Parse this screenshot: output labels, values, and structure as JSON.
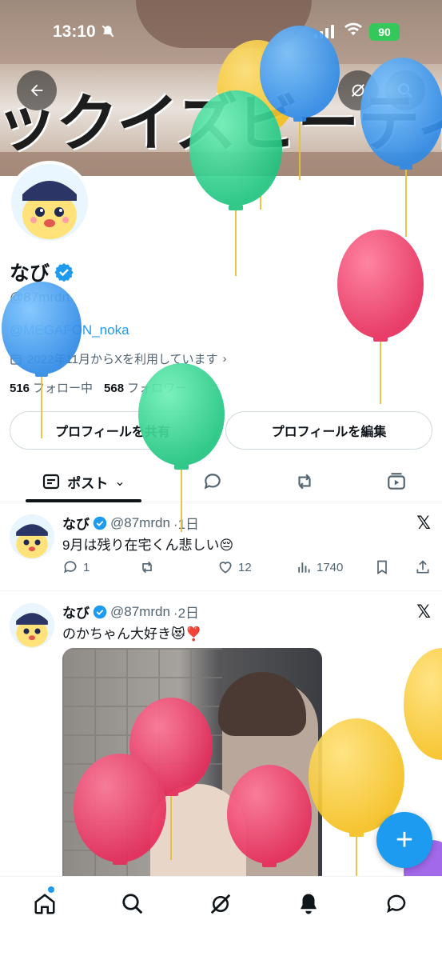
{
  "status_bar": {
    "time": "13:10",
    "battery": "90"
  },
  "header": {
    "banner_text": "ックイズビーティル"
  },
  "profile": {
    "name": "なび",
    "handle": "@87mrdn",
    "bio_link": "@MEGAFON_noka",
    "joined": "2022年11月からXを利用しています",
    "following_count": "516",
    "following_label": "フォロー中",
    "followers_count": "568",
    "followers_label": "フォロワー",
    "share_button": "プロフィールを共有",
    "edit_button": "プロフィールを編集"
  },
  "tabs": {
    "posts_label": "ポスト"
  },
  "posts": [
    {
      "name": "なび",
      "handle": "@87mrdn",
      "time": "·1日",
      "text": "9月は残り在宅くん悲しい😔",
      "replies": "1",
      "reposts": "",
      "likes": "12",
      "views": "1740"
    },
    {
      "name": "なび",
      "handle": "@87mrdn",
      "time": "·2日",
      "text": "のかちゃん大好き😻❣️"
    }
  ],
  "icons": {
    "back": "arrow-left-icon",
    "grok": "grok-icon",
    "search": "search-icon",
    "calendar": "calendar-icon",
    "verified": "verified-badge-icon",
    "x_logo": "x-logo-icon",
    "compose": "plus-icon"
  },
  "colors": {
    "accent": "#1d9bf0",
    "battery": "#34c759",
    "balloon_blue": "#3d9bef",
    "balloon_green": "#2fd38f",
    "balloon_pink": "#ef3c6a",
    "balloon_yellow": "#f5c932"
  }
}
